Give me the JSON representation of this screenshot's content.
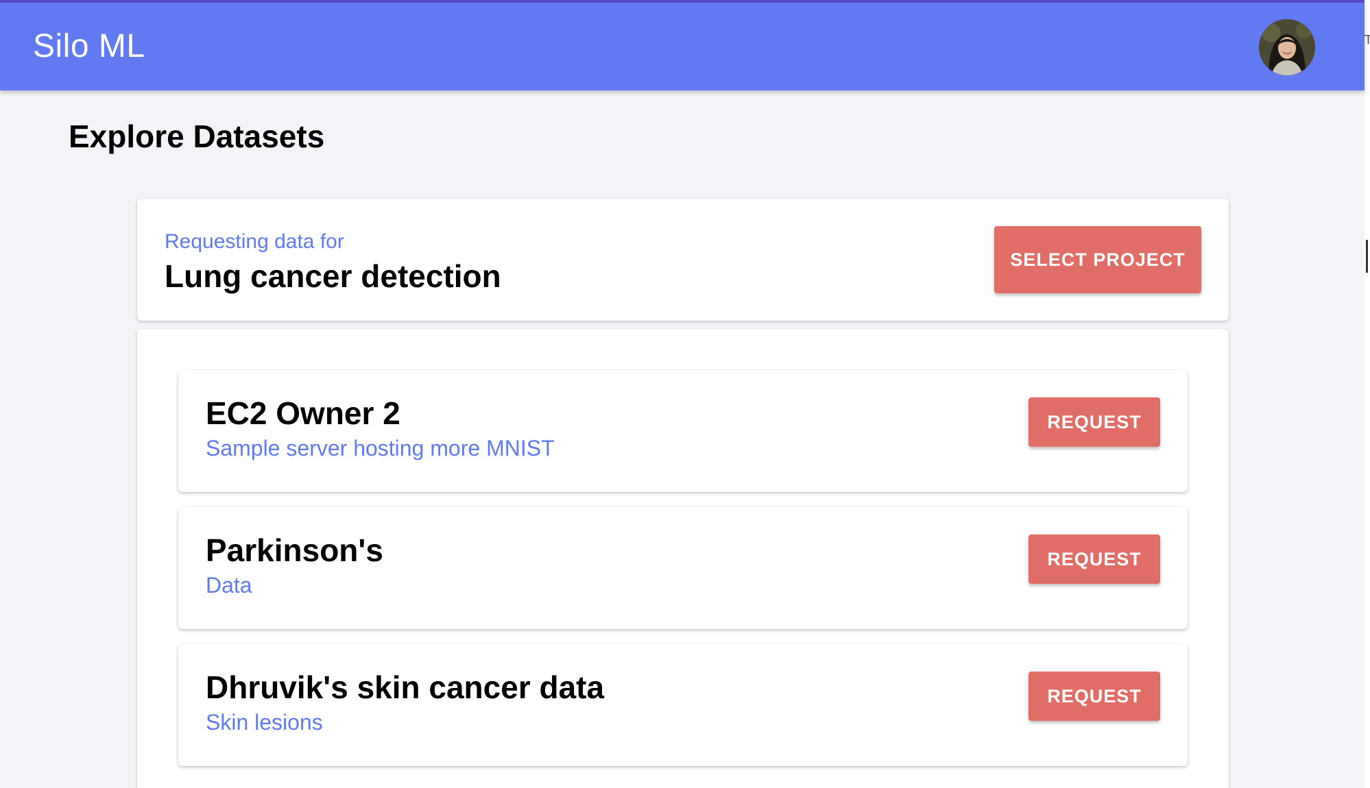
{
  "app": {
    "title": "Silo ML",
    "accent_color": "#627af1",
    "button_color": "#e06e66"
  },
  "header": {
    "avatar_icon": "user-avatar"
  },
  "page": {
    "title": "Explore Datasets"
  },
  "project": {
    "subtitle": "Requesting data for",
    "name": "Lung cancer detection",
    "select_label": "SELECT PROJECT"
  },
  "datasets": [
    {
      "name": "EC2 Owner 2",
      "description": "Sample server hosting more MNIST",
      "action_label": "REQUEST"
    },
    {
      "name": "Parkinson's",
      "description": "Data",
      "action_label": "REQUEST"
    },
    {
      "name": "Dhruvik's skin cancer data",
      "description": "Skin lesions",
      "action_label": "REQUEST"
    }
  ],
  "edge": {
    "clipped_char": "T"
  }
}
